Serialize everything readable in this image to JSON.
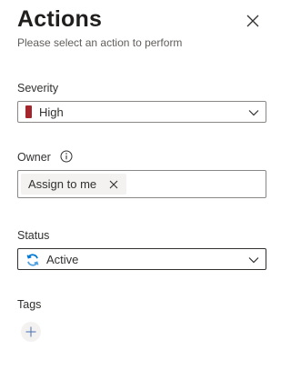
{
  "panel": {
    "title": "Actions",
    "subtitle": "Please select an action to perform",
    "close_icon": "close-icon"
  },
  "severity": {
    "label": "Severity",
    "value": "High",
    "swatch_color": "#a4262c",
    "chevron_icon": "chevron-down-icon"
  },
  "owner": {
    "label": "Owner",
    "info_icon": "info-icon",
    "chip_label": "Assign to me",
    "chip_remove_icon": "close-icon"
  },
  "status": {
    "label": "Status",
    "value": "Active",
    "status_icon": "refresh-icon",
    "status_icon_color": "#0078d4",
    "chevron_icon": "chevron-down-icon"
  },
  "tags": {
    "label": "Tags",
    "add_icon": "plus-icon"
  }
}
